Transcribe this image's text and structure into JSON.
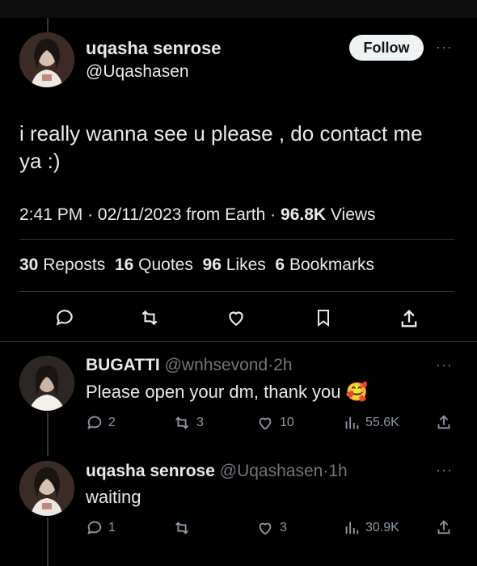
{
  "main_tweet": {
    "display_name": "uqasha senrose",
    "handle": "@Uqashasen",
    "follow_label": "Follow",
    "more_label": "···",
    "text_line1": "i really wanna see u please , do contact me",
    "text_line2": "ya :)",
    "time": "2:41 PM",
    "date": "02/11/2023",
    "source": "from Earth",
    "sep": "·",
    "views_count": "96.8K",
    "views_label": "Views",
    "stats": {
      "reposts_count": "30",
      "reposts_label": "Reposts",
      "quotes_count": "16",
      "quotes_label": "Quotes",
      "likes_count": "96",
      "likes_label": "Likes",
      "bookmarks_count": "6",
      "bookmarks_label": "Bookmarks"
    }
  },
  "replies": [
    {
      "display_name": "BUGATTI",
      "handle": "@wnhsevond",
      "time": "2h",
      "text": "Please open your dm, thank you 🥰",
      "replies": "2",
      "reposts": "3",
      "likes": "10",
      "views": "55.6K"
    },
    {
      "display_name": "uqasha senrose",
      "handle": "@Uqashasen",
      "time": "1h",
      "text": "waiting",
      "replies": "1",
      "reposts": "",
      "likes": "3",
      "views": "30.9K"
    }
  ],
  "colors": {
    "background": "#000000",
    "text": "#e7e9ea",
    "muted": "#71767b",
    "divider": "#2f3336"
  },
  "icons": [
    "reply-icon",
    "repost-icon",
    "like-icon",
    "bookmark-icon",
    "share-icon",
    "views-icon",
    "more-icon"
  ]
}
